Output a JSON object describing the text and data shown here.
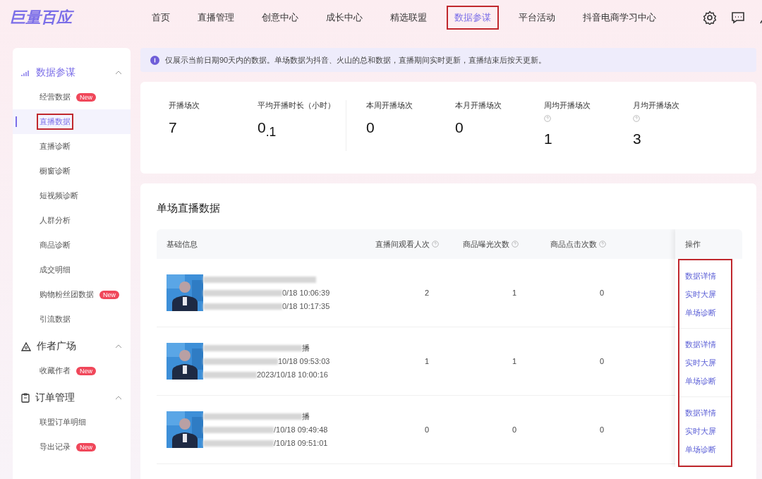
{
  "logo": {
    "text": "巨量百应"
  },
  "nav": [
    {
      "label": "首页",
      "selected": false,
      "highlighted": false
    },
    {
      "label": "直播管理",
      "selected": false,
      "highlighted": false
    },
    {
      "label": "创意中心",
      "selected": false,
      "highlighted": false
    },
    {
      "label": "成长中心",
      "selected": false,
      "highlighted": false
    },
    {
      "label": "精选联盟",
      "selected": false,
      "highlighted": false
    },
    {
      "label": "数据参谋",
      "selected": true,
      "highlighted": true
    },
    {
      "label": "平台活动",
      "selected": false,
      "highlighted": false
    },
    {
      "label": "抖音电商学习中心",
      "selected": false,
      "highlighted": false
    }
  ],
  "sidebar": {
    "groups": [
      {
        "title": "数据参谋",
        "selected": true,
        "expanded": true,
        "items": [
          {
            "label": "经营数据",
            "badge": "New",
            "selected": false,
            "highlighted": false
          },
          {
            "label": "直播数据",
            "selected": true,
            "highlighted": true
          },
          {
            "label": "直播诊断",
            "selected": false,
            "highlighted": false
          },
          {
            "label": "橱窗诊断",
            "selected": false,
            "highlighted": false
          },
          {
            "label": "短视频诊断",
            "selected": false,
            "highlighted": false
          },
          {
            "label": "人群分析",
            "selected": false,
            "highlighted": false
          },
          {
            "label": "商品诊断",
            "selected": false,
            "highlighted": false
          },
          {
            "label": "成交明细",
            "selected": false,
            "highlighted": false
          },
          {
            "label": "购物粉丝团数据",
            "badge": "New",
            "selected": false,
            "highlighted": false
          },
          {
            "label": "引流数据",
            "selected": false,
            "highlighted": false
          }
        ]
      },
      {
        "title": "作者广场",
        "selected": false,
        "expanded": true,
        "items": [
          {
            "label": "收藏作者",
            "badge": "New",
            "selected": false,
            "highlighted": false
          }
        ]
      },
      {
        "title": "订单管理",
        "selected": false,
        "expanded": true,
        "items": [
          {
            "label": "联盟订单明细",
            "selected": false,
            "highlighted": false
          },
          {
            "label": "导出记录",
            "badge": "New",
            "selected": false,
            "highlighted": false
          }
        ]
      }
    ]
  },
  "info_banner": {
    "text": "仅展示当前日期90天内的数据。单场数据为抖音、火山的总和数据，直播期间实时更新，直播结束后按天更新。"
  },
  "stats": [
    {
      "label": "开播场次",
      "value": "7",
      "help": false,
      "divider_after": false
    },
    {
      "label": "平均开播时长（小时）",
      "value": "0$_{.1}$",
      "help": false,
      "divider_after": true
    },
    {
      "label": "本周开播场次",
      "value": "0",
      "help": false,
      "divider_after": false
    },
    {
      "label": "本月开播场次",
      "value": "0",
      "help": false,
      "divider_after": false
    },
    {
      "label": "周均开播场次",
      "value": "1",
      "help": true,
      "divider_after": false
    },
    {
      "label": "月均开播场次",
      "value": "3",
      "help": true,
      "divider_after": false
    }
  ],
  "table": {
    "title": "单场直播数据",
    "info_column": {
      "label": "基础信息"
    },
    "columns": [
      {
        "label": "直播间观看人次",
        "help": true
      },
      {
        "label": "商品曝光次数",
        "help": true
      },
      {
        "label": "商品点击次数",
        "help": true
      }
    ],
    "actions_column": {
      "label": "操作",
      "highlighted": true
    },
    "rows": [
      {
        "title": "",
        "times": [
          "0/18 10:06:39",
          "0/18 10:17:35"
        ],
        "cells": [
          "2",
          "1",
          "0"
        ],
        "actions": [
          "数据详情",
          "实时大屏",
          "单场诊断"
        ]
      },
      {
        "title": "播",
        "times": [
          "10/18 09:53:03",
          "2023/10/18 10:00:16"
        ],
        "cells": [
          "1",
          "1",
          "0"
        ],
        "actions": [
          "数据详情",
          "实时大屏",
          "单场诊断"
        ]
      },
      {
        "title": "播",
        "times": [
          "/10/18 09:49:48",
          "/10/18 09:51:01"
        ],
        "cells": [
          "0",
          "0",
          "0"
        ],
        "actions": [
          "数据详情",
          "实时大屏",
          "单场诊断"
        ]
      }
    ]
  }
}
